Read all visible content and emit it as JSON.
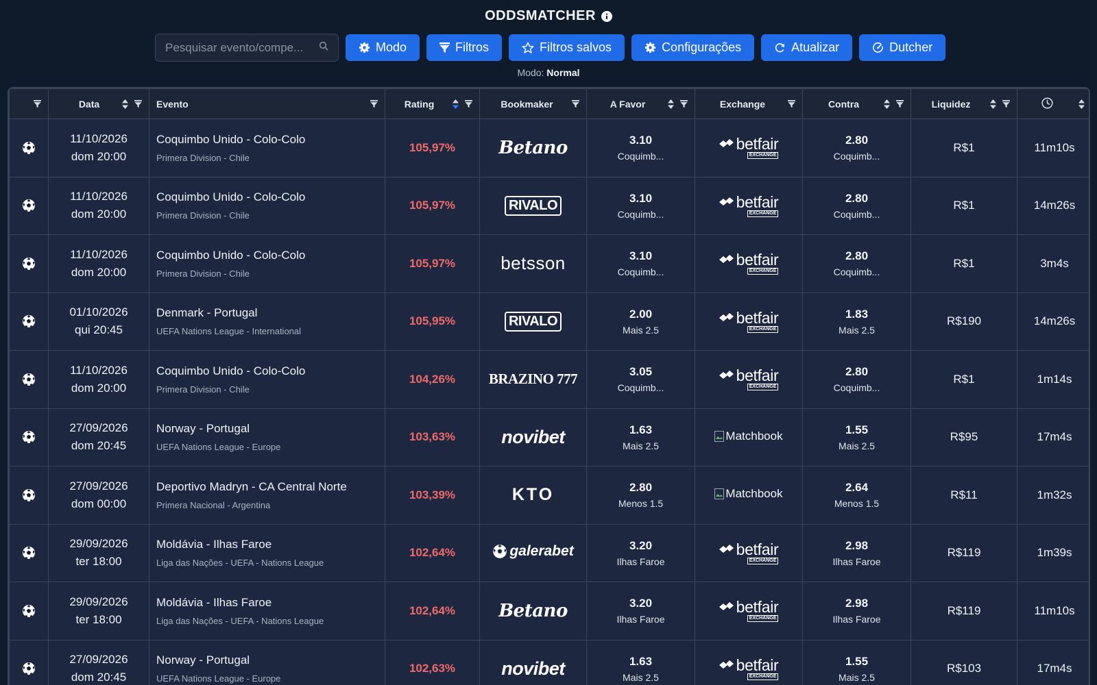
{
  "header": {
    "title": "ODDSMATCHER"
  },
  "search": {
    "placeholder": "Pesquisar evento/compe..."
  },
  "toolbar": {
    "modo": "Modo",
    "filtros": "Filtros",
    "filtros_salvos": "Filtros salvos",
    "configuracoes": "Configurações",
    "atualizar": "Atualizar",
    "dutcher": "Dutcher"
  },
  "mode_status": {
    "label": "Modo:",
    "value": "Normal"
  },
  "colors": {
    "accent": "#1f6be8",
    "rating": "#f06a6a",
    "background": "#0f1a2b"
  },
  "table": {
    "columns": [
      "",
      "Data",
      "Evento",
      "Rating",
      "Bookmaker",
      "A Favor",
      "Exchange",
      "Contra",
      "Liquidez",
      "clock-icon"
    ],
    "rows": [
      {
        "date": "11/10/2026",
        "time": "dom 20:00",
        "event": "Coquimbo Unido - Colo-Colo",
        "league": "Primera Division - Chile",
        "rating": "105,97%",
        "bookmaker": "Betano",
        "favor_odd": "3.10",
        "favor_sel": "Coquimb...",
        "exchange": "betfair",
        "exchange_sub": "EXCHANGE",
        "contra_odd": "2.80",
        "contra_sel": "Coquimb...",
        "liquidez": "R$1",
        "elapsed": "11m10s"
      },
      {
        "date": "11/10/2026",
        "time": "dom 20:00",
        "event": "Coquimbo Unido - Colo-Colo",
        "league": "Primera Division - Chile",
        "rating": "105,97%",
        "bookmaker": "RIVALO",
        "favor_odd": "3.10",
        "favor_sel": "Coquimb...",
        "exchange": "betfair",
        "exchange_sub": "EXCHANGE",
        "contra_odd": "2.80",
        "contra_sel": "Coquimb...",
        "liquidez": "R$1",
        "elapsed": "14m26s"
      },
      {
        "date": "11/10/2026",
        "time": "dom 20:00",
        "event": "Coquimbo Unido - Colo-Colo",
        "league": "Primera Division - Chile",
        "rating": "105,97%",
        "bookmaker": "betsson",
        "favor_odd": "3.10",
        "favor_sel": "Coquimb...",
        "exchange": "betfair",
        "exchange_sub": "EXCHANGE",
        "contra_odd": "2.80",
        "contra_sel": "Coquimb...",
        "liquidez": "R$1",
        "elapsed": "3m4s"
      },
      {
        "date": "01/10/2026",
        "time": "qui 20:45",
        "event": "Denmark - Portugal",
        "league": "UEFA Nations League - International",
        "rating": "105,95%",
        "bookmaker": "RIVALO",
        "favor_odd": "2.00",
        "favor_sel": "Mais 2.5",
        "exchange": "betfair",
        "exchange_sub": "EXCHANGE",
        "contra_odd": "1.83",
        "contra_sel": "Mais 2.5",
        "liquidez": "R$190",
        "elapsed": "14m26s"
      },
      {
        "date": "11/10/2026",
        "time": "dom 20:00",
        "event": "Coquimbo Unido - Colo-Colo",
        "league": "Primera Division - Chile",
        "rating": "104,26%",
        "bookmaker": "BRAZINO 777",
        "favor_odd": "3.05",
        "favor_sel": "Coquimb...",
        "exchange": "betfair",
        "exchange_sub": "EXCHANGE",
        "contra_odd": "2.80",
        "contra_sel": "Coquimb...",
        "liquidez": "R$1",
        "elapsed": "1m14s"
      },
      {
        "date": "27/09/2026",
        "time": "dom 20:45",
        "event": "Norway - Portugal",
        "league": "UEFA Nations League - Europe",
        "rating": "103,63%",
        "bookmaker": "novibet",
        "favor_odd": "1.63",
        "favor_sel": "Mais 2.5",
        "exchange": "Matchbook",
        "exchange_sub": "",
        "contra_odd": "1.55",
        "contra_sel": "Mais 2.5",
        "liquidez": "R$95",
        "elapsed": "17m4s"
      },
      {
        "date": "27/09/2026",
        "time": "dom 00:00",
        "event": "Deportivo Madryn - CA Central Norte",
        "league": "Primera Nacional - Argentina",
        "rating": "103,39%",
        "bookmaker": "KTO",
        "favor_odd": "2.80",
        "favor_sel": "Menos 1.5",
        "exchange": "Matchbook",
        "exchange_sub": "",
        "contra_odd": "2.64",
        "contra_sel": "Menos 1.5",
        "liquidez": "R$11",
        "elapsed": "1m32s"
      },
      {
        "date": "29/09/2026",
        "time": "ter 18:00",
        "event": "Moldávia - Ilhas Faroe",
        "league": "Liga das Nações - UEFA - Nations League",
        "rating": "102,64%",
        "bookmaker": "galerabet",
        "favor_odd": "3.20",
        "favor_sel": "Ilhas Faroe",
        "exchange": "betfair",
        "exchange_sub": "EXCHANGE",
        "contra_odd": "2.98",
        "contra_sel": "Ilhas Faroe",
        "liquidez": "R$119",
        "elapsed": "1m39s"
      },
      {
        "date": "29/09/2026",
        "time": "ter 18:00",
        "event": "Moldávia - Ilhas Faroe",
        "league": "Liga das Nações - UEFA - Nations League",
        "rating": "102,64%",
        "bookmaker": "Betano",
        "favor_odd": "3.20",
        "favor_sel": "Ilhas Faroe",
        "exchange": "betfair",
        "exchange_sub": "EXCHANGE",
        "contra_odd": "2.98",
        "contra_sel": "Ilhas Faroe",
        "liquidez": "R$119",
        "elapsed": "11m10s"
      },
      {
        "date": "27/09/2026",
        "time": "dom 20:45",
        "event": "Norway - Portugal",
        "league": "UEFA Nations League - Europe",
        "rating": "102,63%",
        "bookmaker": "novibet",
        "favor_odd": "1.63",
        "favor_sel": "Mais 2.5",
        "exchange": "betfair",
        "exchange_sub": "EXCHANGE",
        "contra_odd": "1.55",
        "contra_sel": "Mais 2.5",
        "liquidez": "R$103",
        "elapsed": "17m4s"
      }
    ]
  }
}
